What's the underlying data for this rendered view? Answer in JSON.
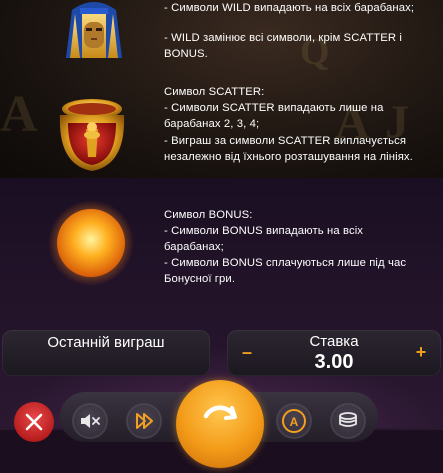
{
  "wild_rules": {
    "line1": "- Символи WILD випадають на всіх барабанах;",
    "line2": "- WILD замінює всі символи, крім SCATTER і BONUS."
  },
  "scatter_rules": {
    "title": "Символ SCATTER:",
    "line1": "- Символи SCATTER випадають лише на барабанах 2, 3, 4;",
    "line2": "- Виграш за символи SCATTER виплачується незалежно від їхнього розташування на лініях."
  },
  "bonus_rules": {
    "title": "Символ BONUS:",
    "line1": "- Символи BONUS випадають на всіх барабанах;",
    "line2": "- Символи BONUS сплачуються лише під час Бонусної гри."
  },
  "bottom_panel": {
    "last_win_label": "Останній виграш",
    "stake_label": "Ставка",
    "stake_value": "3.00",
    "minus_label": "–",
    "plus_label": "+"
  },
  "icons": {
    "wild_symbol": "pharaoh-mask-icon",
    "scatter_symbol": "golden-pot-icon",
    "bonus_symbol": "sun-icon",
    "close": "close-icon",
    "sound": "sound-off-icon",
    "fast": "fast-forward-icon",
    "spin": "spin-icon",
    "autoplay": "autoplay-icon",
    "coins": "coins-icon"
  },
  "colors": {
    "accent": "#f39a18",
    "close": "#d23030",
    "text": "#ffffff"
  }
}
